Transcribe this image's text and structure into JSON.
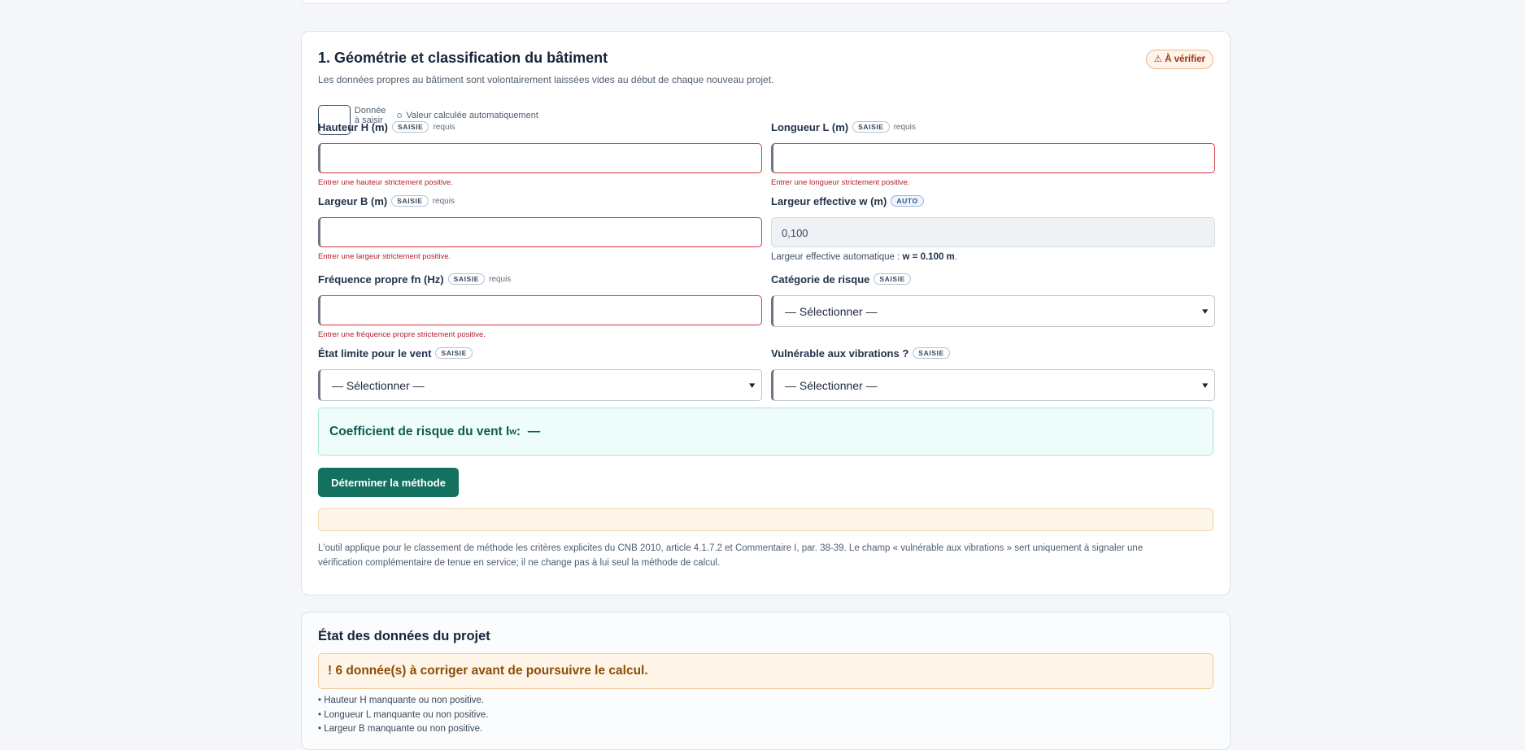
{
  "section": {
    "title": "1. Géométrie et classification du bâtiment",
    "badge": "⚠ À vérifier",
    "intro": "Les données propres au bâtiment sont volontairement laissées vides au début de chaque nouveau projet.",
    "legend_input": "Donnée à saisir",
    "legend_auto": "Valeur calculée automatiquement"
  },
  "tags": {
    "input": "SAISIE",
    "auto": "AUTO",
    "required": "requis"
  },
  "fields": {
    "hauteur": {
      "label": "Hauteur H (m)",
      "error": "Entrer une hauteur strictement positive.",
      "value": ""
    },
    "longueur": {
      "label": "Longueur L (m)",
      "error": "Entrer une longueur strictement positive.",
      "value": ""
    },
    "largeur": {
      "label": "Largeur B (m)",
      "error": "Entrer une largeur strictement positive.",
      "value": ""
    },
    "largeur_eff": {
      "label": "Largeur effective w (m)",
      "value": "0,100",
      "help": "Largeur effective automatique : ",
      "help_value": "w = 0.100 m",
      "help_end": "."
    },
    "frequence": {
      "label": "Fréquence propre fn (Hz)",
      "error": "Entrer une fréquence propre strictement positive.",
      "value": ""
    },
    "categorie": {
      "label": "Catégorie de risque",
      "selected": "— Sélectionner —"
    },
    "etat_limite": {
      "label": "État limite pour le vent",
      "selected": "— Sélectionner —"
    },
    "vibrations": {
      "label": "Vulnérable aux vibrations ?",
      "selected": "— Sélectionner —"
    }
  },
  "coef": {
    "label": "Coefficient de risque du vent I",
    "sub": "w",
    "colon": " :",
    "value": "—"
  },
  "button": {
    "label": "Déterminer la méthode"
  },
  "note": "L'outil applique pour le classement de méthode les critères explicites du CNB 2010, article 4.1.7.2 et Commentaire I, par. 38-39. Le champ « vulnérable aux vibrations » sert uniquement à signaler une vérification complémentaire de tenue en service; il ne change pas à lui seul la méthode de calcul.",
  "status": {
    "title": "État des données du projet",
    "alert": "! 6 donnée(s) à corriger avant de poursuivre le calcul.",
    "issues": [
      "• Hauteur H manquante ou non positive.",
      "• Longueur L manquante ou non positive.",
      "• Largeur B manquante ou non positive."
    ]
  },
  "colors": {
    "primary": "#14705f",
    "error": "#d8363e",
    "warning": "#a4300f"
  },
  "icons": {
    "select": "chevron-down-icon",
    "badge": "warning-icon"
  }
}
